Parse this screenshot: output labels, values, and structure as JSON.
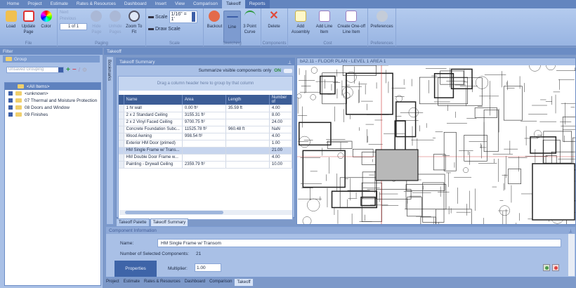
{
  "menu": {
    "tabs": [
      "Home",
      "Project",
      "Estimate",
      "Rates & Resources",
      "Dashboard",
      "Insert",
      "View",
      "Comparison",
      "Takeoff",
      "Reports"
    ],
    "active": "Takeoff"
  },
  "ribbon": {
    "file": {
      "label": "File",
      "load": "Load",
      "update": "Update Page",
      "color": "Color"
    },
    "paging": {
      "label": "Paging",
      "next": "Next",
      "previous": "Previous",
      "page": "1 of 1",
      "hide": "Hide Page",
      "unhide": "Unhide Pages",
      "zoom": "Zoom To Fit"
    },
    "scale": {
      "label": "Scale",
      "scale": "Scale",
      "value": "1/16\" = 1'",
      "draw": "Draw Scale"
    },
    "sketching": {
      "label": "Sketching",
      "backout": "Backout",
      "line": "Line",
      "curve": "3 Point Curve"
    },
    "components": {
      "label": "Components",
      "delete": "Delete"
    },
    "cost": {
      "label": "Cost",
      "assembly": "Add Assembly",
      "lineitem": "Add Line Item",
      "oneoff": "Create One-off Line Item"
    },
    "preferences": {
      "label": "Preferences",
      "prefs": "Preferences"
    }
  },
  "filter": {
    "title": "Filter",
    "group_title": "Group",
    "grouping": "Unsaved Grouping",
    "tree": [
      "<All Items>",
      "<unknown>",
      "07 Thermal and Moisture Protection",
      "08 Doors and Window",
      "09 Finishes"
    ]
  },
  "takeoff": {
    "title": "Takeoff",
    "bookmarks": "Bookmarks",
    "summary": {
      "title": "Takeoff Summary",
      "toggle_label": "Summarize visible components only",
      "toggle_state": "ON",
      "group_hint": "Drag a column header here to group by that column",
      "columns": [
        "Name",
        "Area",
        "Length",
        "Number of"
      ],
      "rows": [
        [
          "1 hr wall",
          "0.00 ft²",
          "35.59 ft",
          "4.00"
        ],
        [
          "2 x 2 Standard Ceiling",
          "3155.31 ft²",
          "",
          "8.00"
        ],
        [
          "2 x 2 Vinyl Faced Ceiling",
          "9700.75 ft²",
          "",
          "24.00"
        ],
        [
          "Concrete Foundation Subc...",
          "11525.78 ft²",
          "960.48 ft",
          "NaN"
        ],
        [
          "Wood Awning",
          "998.54 ft²",
          "",
          "4.00"
        ],
        [
          "Exterior HM Door (primed)",
          "",
          "",
          "1.00"
        ],
        [
          "HM Single Frame w/ Trans...",
          "",
          "",
          "21.00"
        ],
        [
          "HM Double Door Frame w...",
          "",
          "",
          "4.00"
        ],
        [
          "Painting - Drywall Ceiling",
          "2359.79 ft²",
          "",
          "10.00"
        ]
      ],
      "selected_row": 6
    },
    "tabs": [
      "Takeoff Palette",
      "Takeoff Summary"
    ],
    "plan_title": "bA2.11 - FLOOR PLAN - LEVEL 1 AREA 1"
  },
  "component": {
    "title": "Component Information",
    "name_label": "Name:",
    "name": "HM Single Frame w/ Transom",
    "count_label": "Number of Selected Components:",
    "count": "21",
    "properties": "Properties",
    "multiplier_label": "Multiplier:",
    "multiplier": "1.00"
  },
  "bottom_tabs": [
    "Project",
    "Estimate",
    "Rates & Resources",
    "Dashboard",
    "Comparison",
    "Takeoff"
  ],
  "colors": {
    "accent": "#6b8cc4",
    "header": "#3c5d96",
    "toggle_on": "#2e8b3a"
  }
}
